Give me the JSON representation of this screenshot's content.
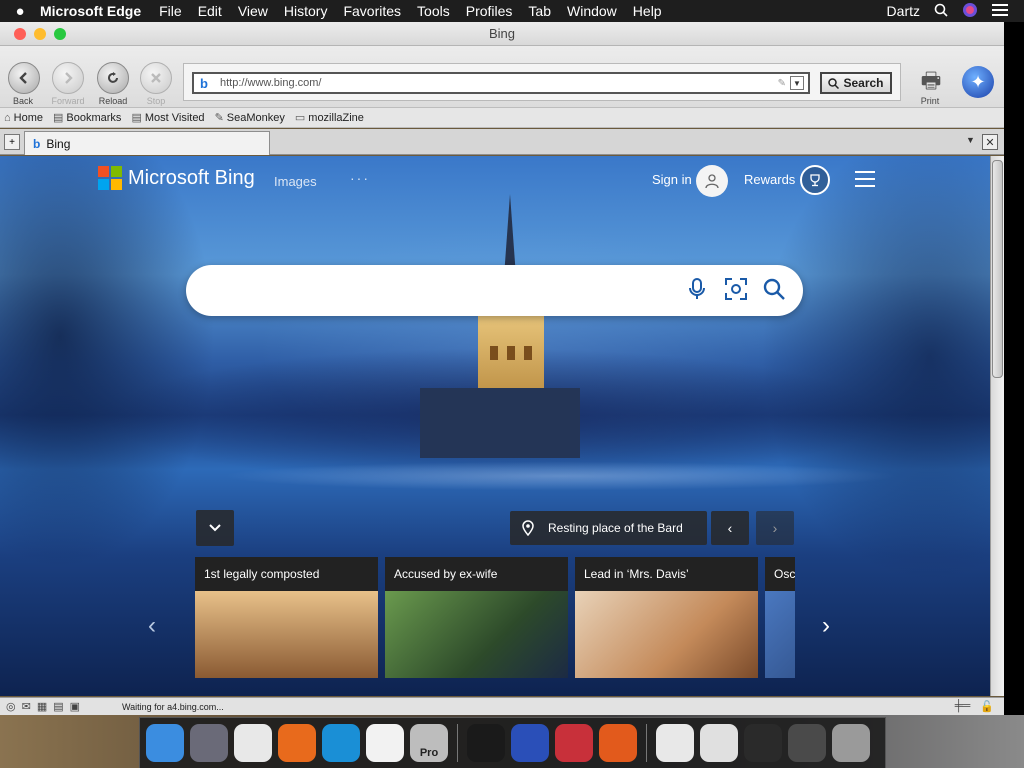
{
  "menubar": {
    "apple": "",
    "app_name": "Microsoft Edge",
    "items": [
      "File",
      "Edit",
      "View",
      "History",
      "Favorites",
      "Tools",
      "Profiles",
      "Tab",
      "Window",
      "Help"
    ],
    "user": "Dartz"
  },
  "window": {
    "title": "Bing"
  },
  "toolbar": {
    "back": "Back",
    "forward": "Forward",
    "reload": "Reload",
    "stop": "Stop",
    "url": "http://www.bing.com/",
    "search_label": "Search",
    "print_label": "Print"
  },
  "bookmarks": [
    "Home",
    "Bookmarks",
    "Most Visited",
    "SeaMonkey",
    "mozillaZine"
  ],
  "tab": {
    "label": "Bing"
  },
  "bing": {
    "logo_text": "Microsoft Bing",
    "nav_images": "Images",
    "nav_more": "···",
    "sign_in": "Sign in",
    "rewards": "Rewards",
    "search_placeholder": "",
    "location_label": "Resting place of the Bard",
    "cards": [
      {
        "caption": "1st legally composted",
        "color": "#a0764a"
      },
      {
        "caption": "Accused by ex-wife",
        "color": "#5a8a4a"
      },
      {
        "caption": "Lead in ‘Mrs. Davis’",
        "color": "#caa27c"
      },
      {
        "caption": "Osc",
        "color": "#3a5fa0"
      }
    ]
  },
  "statusbar": {
    "text": "Waiting for a4.bing.com..."
  },
  "dock": {
    "apps": [
      {
        "name": "finder-icon",
        "color": "#3b8de0",
        "glyph": ""
      },
      {
        "name": "launchpad-icon",
        "color": "#6a6a78",
        "glyph": ""
      },
      {
        "name": "chrome-icon",
        "color": "#e8e8e8",
        "glyph": ""
      },
      {
        "name": "firefox-icon",
        "color": "#e86a1c",
        "glyph": ""
      },
      {
        "name": "edge-icon",
        "color": "#1a8fd6",
        "glyph": ""
      },
      {
        "name": "vscode-icon",
        "color": "#f2f2f2",
        "glyph": ""
      },
      {
        "name": "pro-app-icon",
        "color": "#bdbdbd",
        "glyph": "Pro"
      },
      {
        "name": "terminal-icon",
        "color": "#1a1a1a",
        "glyph": ""
      },
      {
        "name": "seamonkey-icon",
        "color": "#2a4fb8",
        "glyph": ""
      },
      {
        "name": "parallels-icon",
        "color": "#c8303a",
        "glyph": ""
      },
      {
        "name": "ubuntu-icon",
        "color": "#e25a1c",
        "glyph": ""
      },
      {
        "name": "blocked-icon",
        "color": "#e8e8e8",
        "glyph": ""
      },
      {
        "name": "document-icon",
        "color": "#e0e0e0",
        "glyph": ""
      },
      {
        "name": "screens-icon",
        "color": "#2a2a2a",
        "glyph": ""
      },
      {
        "name": "preview-icon",
        "color": "#4a4a4a",
        "glyph": ""
      },
      {
        "name": "trash-icon",
        "color": "#9a9a9a",
        "glyph": ""
      }
    ]
  }
}
